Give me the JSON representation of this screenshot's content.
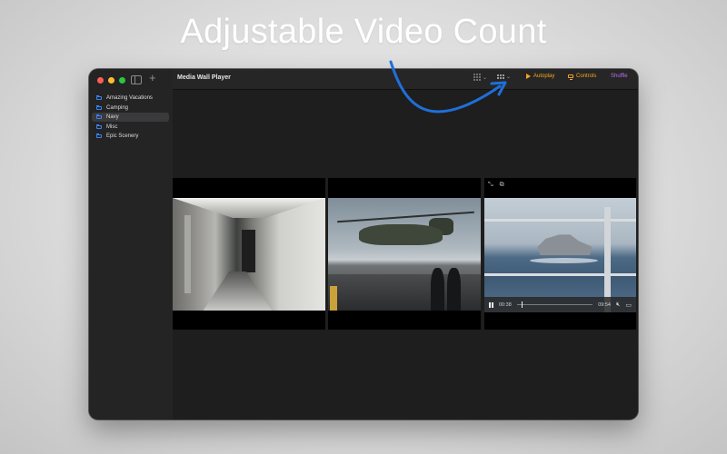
{
  "banner": {
    "headline": "Adjustable Video Count"
  },
  "window": {
    "title": "Media Wall Player",
    "toolbar": {
      "autoplay_label": "Autoplay",
      "controls_label": "Controls",
      "shuffle_label": "Shuffle"
    }
  },
  "sidebar": {
    "items": [
      {
        "label": "Amazing Vacations",
        "selected": false
      },
      {
        "label": "Camping",
        "selected": false
      },
      {
        "label": "Navy",
        "selected": true
      },
      {
        "label": "Misc",
        "selected": false
      },
      {
        "label": "Epic Scenery",
        "selected": false
      }
    ]
  },
  "player": {
    "current_time": "00:38",
    "duration": "09:54",
    "progress": 0.064
  },
  "colors": {
    "accent_orange": "#f5a623",
    "accent_purple": "#b86ff0",
    "folder_blue": "#3b82f6",
    "annotation_arrow": "#1f6fd9"
  }
}
